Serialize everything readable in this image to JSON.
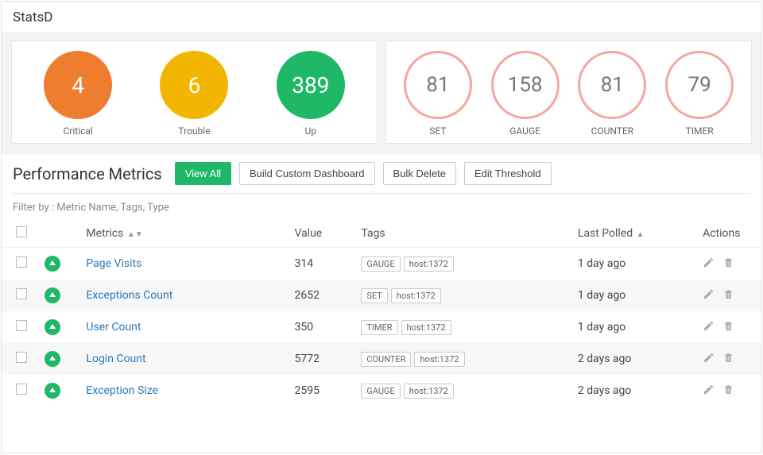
{
  "header": {
    "title": "StatsD"
  },
  "status": {
    "items": [
      {
        "value": "4",
        "label": "Critical",
        "color": "#ef7d30"
      },
      {
        "value": "6",
        "label": "Trouble",
        "color": "#f3b600"
      },
      {
        "value": "389",
        "label": "Up",
        "color": "#1fb866"
      }
    ]
  },
  "types": {
    "items": [
      {
        "value": "81",
        "label": "SET"
      },
      {
        "value": "158",
        "label": "GAUGE"
      },
      {
        "value": "81",
        "label": "COUNTER"
      },
      {
        "value": "79",
        "label": "TIMER"
      }
    ]
  },
  "section": {
    "title": "Performance Metrics",
    "view_all": "View All",
    "build_dashboard": "Build Custom Dashboard",
    "bulk_delete": "Bulk Delete",
    "edit_threshold": "Edit Threshold"
  },
  "filter": {
    "label": "Filter by : Metric Name, Tags, Type"
  },
  "columns": {
    "metrics": "Metrics",
    "value": "Value",
    "tags": "Tags",
    "last_polled": "Last Polled",
    "actions": "Actions"
  },
  "rows": [
    {
      "name": "Page Visits",
      "value": "314",
      "tag_type": "GAUGE",
      "tag_host": "host:1372",
      "polled": "1 day ago"
    },
    {
      "name": "Exceptions Count",
      "value": "2652",
      "tag_type": "SET",
      "tag_host": "host:1372",
      "polled": "1 day ago"
    },
    {
      "name": "User Count",
      "value": "350",
      "tag_type": "TIMER",
      "tag_host": "host:1372",
      "polled": "1 day ago"
    },
    {
      "name": "Login Count",
      "value": "5772",
      "tag_type": "COUNTER",
      "tag_host": "host:1372",
      "polled": "2 days ago"
    },
    {
      "name": "Exception Size",
      "value": "2595",
      "tag_type": "GAUGE",
      "tag_host": "host:1372",
      "polled": "2 days ago"
    }
  ]
}
